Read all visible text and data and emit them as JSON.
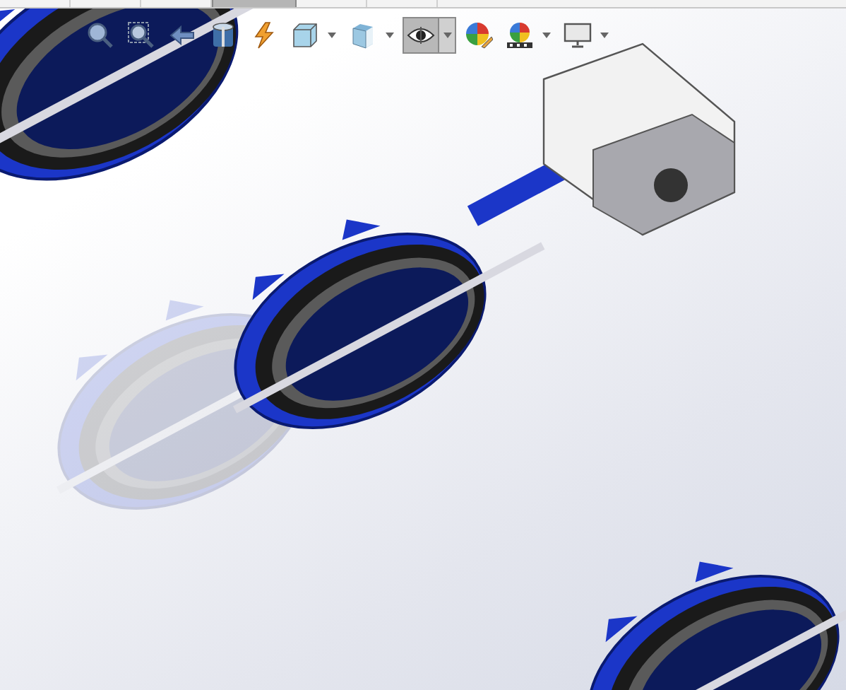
{
  "top_tabs": [
    {
      "selected": false
    },
    {
      "selected": false
    },
    {
      "selected": false
    },
    {
      "selected": true
    },
    {
      "selected": false
    },
    {
      "selected": false
    }
  ],
  "toolbar": [
    {
      "kind": "zoom-fit",
      "selected": false
    },
    {
      "kind": "zoom-area",
      "selected": false
    },
    {
      "kind": "previous-view",
      "selected": false
    },
    {
      "kind": "section",
      "selected": false
    },
    {
      "kind": "annotation",
      "selected": false
    },
    {
      "kind": "orientation",
      "selected": false
    },
    {
      "kind": "caret",
      "selected": false
    },
    {
      "kind": "display-style",
      "selected": false
    },
    {
      "kind": "caret",
      "selected": false
    },
    {
      "kind": "hide-show",
      "selected": true
    },
    {
      "kind": "caret",
      "selected": true
    },
    {
      "kind": "appearance",
      "selected": false
    },
    {
      "kind": "scene",
      "selected": false
    },
    {
      "kind": "caret",
      "selected": false
    },
    {
      "kind": "view-settings",
      "selected": false
    },
    {
      "kind": "caret",
      "selected": false
    }
  ]
}
